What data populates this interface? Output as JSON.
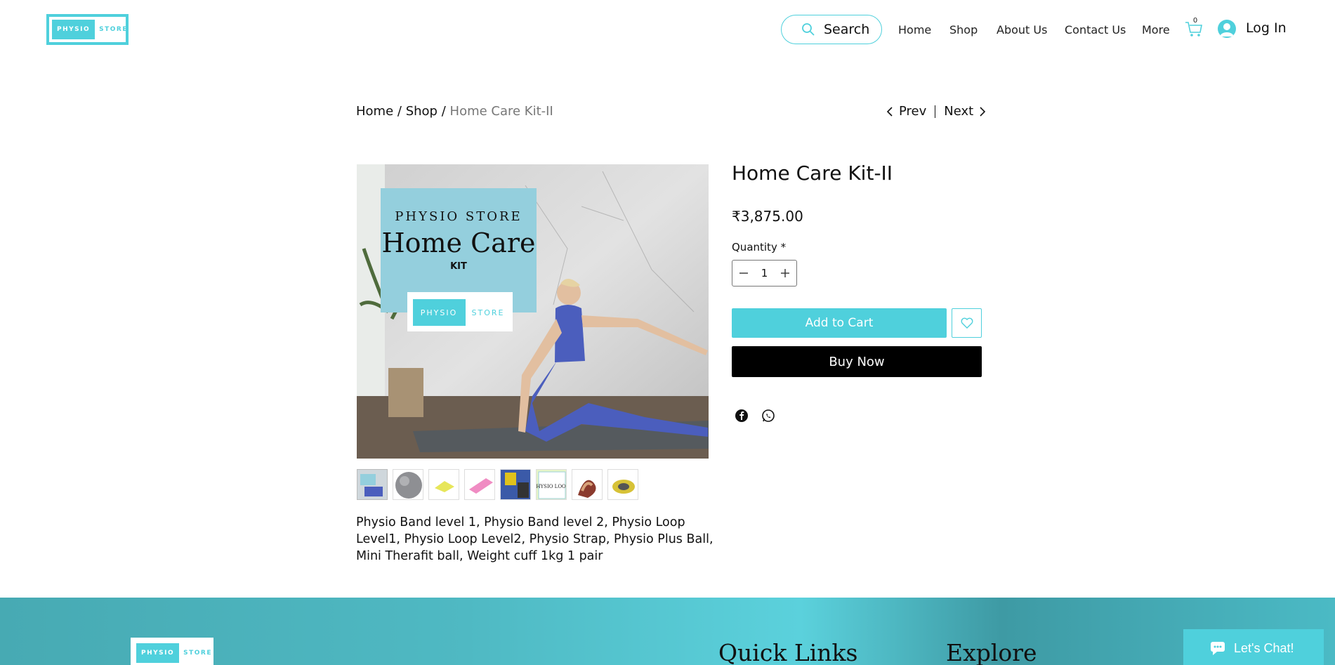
{
  "header": {
    "logo": {
      "left": "PHYSIO",
      "right": "STORE"
    },
    "search_label": "Search",
    "nav": [
      "Home",
      "Shop",
      "About Us",
      "Contact Us",
      "More"
    ],
    "cart_count": "0",
    "login_label": "Log In"
  },
  "breadcrumb": {
    "home": "Home",
    "sep": "/",
    "shop": "Shop",
    "current": "Home Care Kit-II"
  },
  "pager": {
    "prev": "Prev",
    "next": "Next"
  },
  "product": {
    "title": "Home Care Kit-II",
    "price": "₹3,875.00",
    "quantity_label": "Quantity *",
    "quantity_value": "1",
    "add_to_cart": "Add to Cart",
    "buy_now": "Buy Now",
    "description": "Physio Band level 1, Physio Band level 2, Physio Loop Level1, Physio Loop Level2, Physio Strap, Physio Plus Ball, Mini Therafit ball, Weight cuff 1kg 1 pair",
    "image_texts": {
      "brand": "PHYSIO STORE",
      "headline": "Home Care",
      "sub": "KIT"
    },
    "thumbnail_count": 8
  },
  "share": [
    "facebook-icon",
    "whatsapp-icon"
  ],
  "footer": {
    "logo": {
      "left": "PHYSIO",
      "right": "STORE"
    },
    "quick_links": "Quick Links",
    "explore": "Explore"
  },
  "chat": {
    "label": "Let's Chat!"
  },
  "colors": {
    "accent": "#4fd0dc",
    "black": "#000000"
  }
}
